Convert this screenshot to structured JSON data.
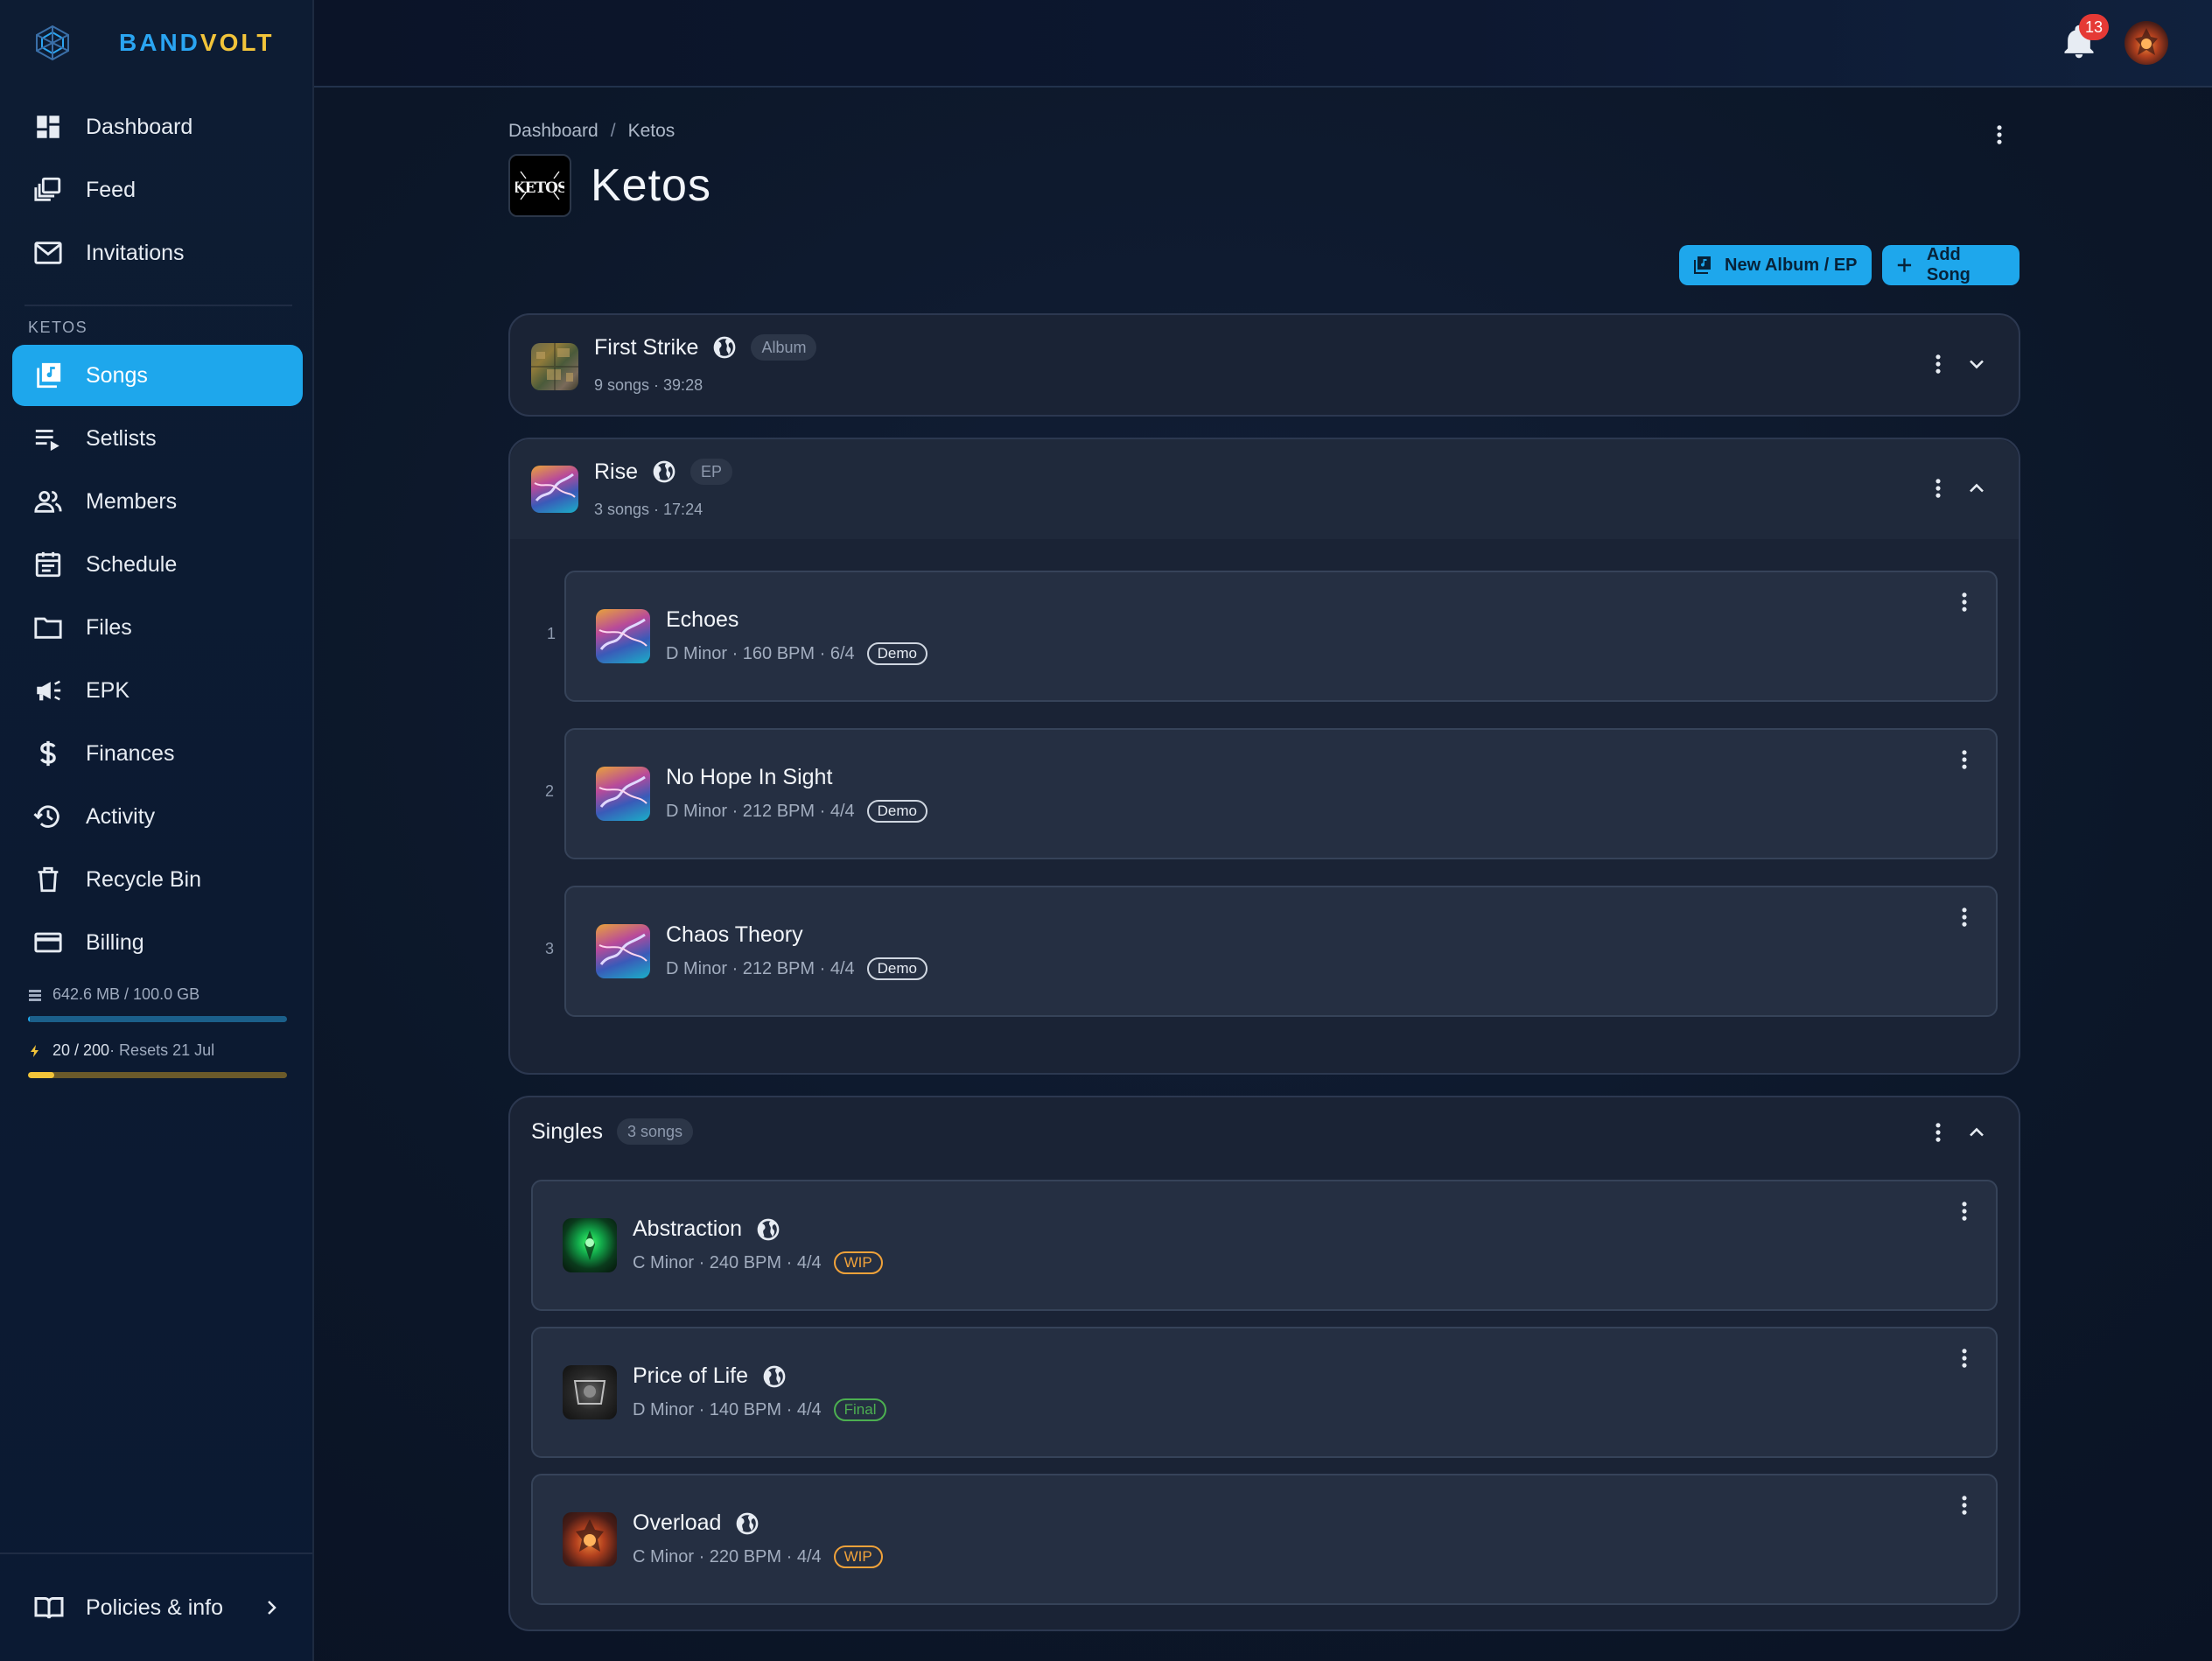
{
  "brand": {
    "name_part1": "BAND",
    "name_part2": "VOLT"
  },
  "sidebar": {
    "top_items": [
      {
        "label": "Dashboard",
        "icon": "dashboard-icon"
      },
      {
        "label": "Feed",
        "icon": "feed-icon"
      },
      {
        "label": "Invitations",
        "icon": "mail-icon"
      }
    ],
    "section_label": "KETOS",
    "band_items": [
      {
        "label": "Songs",
        "icon": "songs-icon",
        "active": true
      },
      {
        "label": "Setlists",
        "icon": "setlist-icon"
      },
      {
        "label": "Members",
        "icon": "members-icon"
      },
      {
        "label": "Schedule",
        "icon": "calendar-icon"
      },
      {
        "label": "Files",
        "icon": "folder-icon"
      },
      {
        "label": "EPK",
        "icon": "megaphone-icon"
      },
      {
        "label": "Finances",
        "icon": "dollar-icon"
      },
      {
        "label": "Activity",
        "icon": "history-icon"
      },
      {
        "label": "Recycle Bin",
        "icon": "trash-icon"
      },
      {
        "label": "Billing",
        "icon": "card-icon"
      }
    ],
    "storage": {
      "text": "642.6 MB / 100.0 GB",
      "fraction": 0.006,
      "color": "#1ea7ec"
    },
    "credits": {
      "used": "20 / 200",
      "suffix": " · Resets 21 Jul",
      "fraction": 0.1,
      "color": "#f2c43a"
    },
    "policies_label": "Policies & info"
  },
  "topbar": {
    "notification_count": "13"
  },
  "breadcrumb": {
    "root": "Dashboard",
    "separator": "/",
    "current": "Ketos"
  },
  "page": {
    "title": "Ketos",
    "logo_text": "KETOS"
  },
  "actions": {
    "new_album_label": "New Album / EP",
    "add_song_label": "Add Song"
  },
  "albums": [
    {
      "title": "First Strike",
      "type": "Album",
      "subtitle": "9 songs · 39:28",
      "expanded": false
    },
    {
      "title": "Rise",
      "type": "EP",
      "subtitle": "3 songs · 17:24",
      "expanded": true,
      "songs": [
        {
          "num": "1",
          "title": "Echoes",
          "meta": "D Minor · 160 BPM · 6/4",
          "tag": "Demo"
        },
        {
          "num": "2",
          "title": "No Hope In Sight",
          "meta": "D Minor · 212 BPM · 4/4",
          "tag": "Demo"
        },
        {
          "num": "3",
          "title": "Chaos Theory",
          "meta": "D Minor · 212 BPM · 4/4",
          "tag": "Demo"
        }
      ]
    }
  ],
  "singles": {
    "title": "Singles",
    "count": "3 songs",
    "songs": [
      {
        "title": "Abstraction",
        "meta": "C Minor · 240 BPM · 4/4",
        "tag": "WIP"
      },
      {
        "title": "Price of Life",
        "meta": "D Minor · 140 BPM · 4/4",
        "tag": "Final"
      },
      {
        "title": "Overload",
        "meta": "C Minor · 220 BPM · 4/4",
        "tag": "WIP"
      }
    ]
  },
  "colors": {
    "accent": "#1ea7ec",
    "brand_blue": "#2aa5f2",
    "brand_yellow": "#f2c43a",
    "wip": "#f0a23a",
    "final": "#4caf50",
    "badge": "#e53935"
  }
}
